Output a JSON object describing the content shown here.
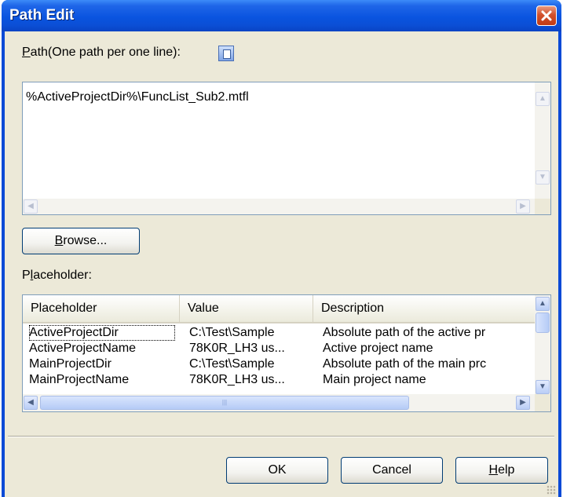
{
  "window": {
    "title": "Path Edit"
  },
  "path_section": {
    "label_underlined": "P",
    "label_rest": "ath(One path per one line):",
    "textarea_value": "%ActiveProjectDir%\\FuncList_Sub2.mtfl"
  },
  "browse_button": {
    "underlined": "B",
    "rest": "rowse..."
  },
  "placeholder_section": {
    "label_pre": "P",
    "label_underlined": "l",
    "label_rest": "aceholder:",
    "columns": [
      "Placeholder",
      "Value",
      "Description"
    ],
    "rows": [
      {
        "placeholder": "ActiveProjectDir",
        "value": "C:\\Test\\Sample",
        "description": "Absolute path of the active pr"
      },
      {
        "placeholder": "ActiveProjectName",
        "value": "78K0R_LH3 us...",
        "description": "Active project name"
      },
      {
        "placeholder": "MainProjectDir",
        "value": "C:\\Test\\Sample",
        "description": "Absolute path of the main prc"
      },
      {
        "placeholder": "MainProjectName",
        "value": "78K0R_LH3 us...",
        "description": "Main project name"
      }
    ]
  },
  "buttons": {
    "ok": "OK",
    "cancel": "Cancel",
    "help_underlined": "H",
    "help_rest": "elp"
  },
  "colors": {
    "title_bar": "#0a54e0",
    "dialog_face": "#ece9d8",
    "close_button": "#d2512d",
    "button_border": "#003c74"
  },
  "icons": {
    "close": "close-x-icon",
    "info": "info-icon",
    "scroll_up": "up-arrow",
    "scroll_down": "down-arrow",
    "scroll_left": "left-arrow",
    "scroll_right": "right-arrow"
  }
}
